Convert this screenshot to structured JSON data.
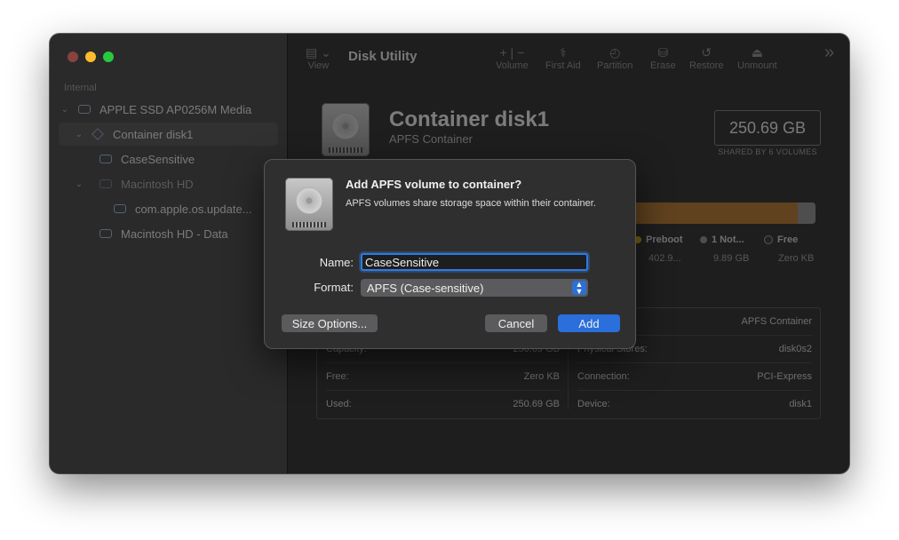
{
  "window": {
    "title": "Disk Utility"
  },
  "toolbar": {
    "view_label": "View",
    "volume_label": "Volume",
    "first_aid_label": "First Aid",
    "partition_label": "Partition",
    "erase_label": "Erase",
    "restore_label": "Restore",
    "unmount_label": "Unmount",
    "volume_glyph": "+ | −",
    "overflow_glyph": "»"
  },
  "sidebar": {
    "section": "Internal",
    "items": [
      {
        "label": "APPLE SSD AP0256M Media"
      },
      {
        "label": "Container disk1"
      },
      {
        "label": "CaseSensitive"
      },
      {
        "label": "Macintosh HD"
      },
      {
        "label": "com.apple.os.update..."
      },
      {
        "label": "Macintosh HD - Data"
      }
    ]
  },
  "header": {
    "title": "Container disk1",
    "subtitle": "APFS Container",
    "capacity": "250.69 GB",
    "capacity_note": "SHARED BY 6 VOLUMES"
  },
  "legend": [
    {
      "name": "Preboot",
      "value": "402.9...",
      "color": "#e0b400"
    },
    {
      "name": "1 Not...",
      "value": "9.89 GB",
      "color": "#8a8a8a"
    },
    {
      "name": "Free",
      "value": "Zero KB",
      "color": "#2a2a2a"
    }
  ],
  "info": {
    "left": [
      {
        "key": "Capacity:",
        "value": "250.69 GB"
      },
      {
        "key": "Free:",
        "value": "Zero KB"
      },
      {
        "key": "Used:",
        "value": "250.69 GB"
      }
    ],
    "right": [
      {
        "key": "",
        "value": "APFS Container"
      },
      {
        "key": "Physical Stores:",
        "value": "disk0s2"
      },
      {
        "key": "Connection:",
        "value": "PCI-Express"
      },
      {
        "key": "Device:",
        "value": "disk1"
      }
    ]
  },
  "dialog": {
    "title": "Add APFS volume to container?",
    "message": "APFS volumes share storage space within their container.",
    "name_label": "Name:",
    "name_value": "CaseSensitive",
    "format_label": "Format:",
    "format_value": "APFS (Case-sensitive)",
    "size_options_label": "Size Options...",
    "cancel_label": "Cancel",
    "add_label": "Add"
  },
  "colors": {
    "accent": "#2a6fdb",
    "used_bar": "#b06f1f",
    "traffic_close": "#ff5f57",
    "traffic_min": "#febc2e",
    "traffic_max": "#28c840"
  }
}
